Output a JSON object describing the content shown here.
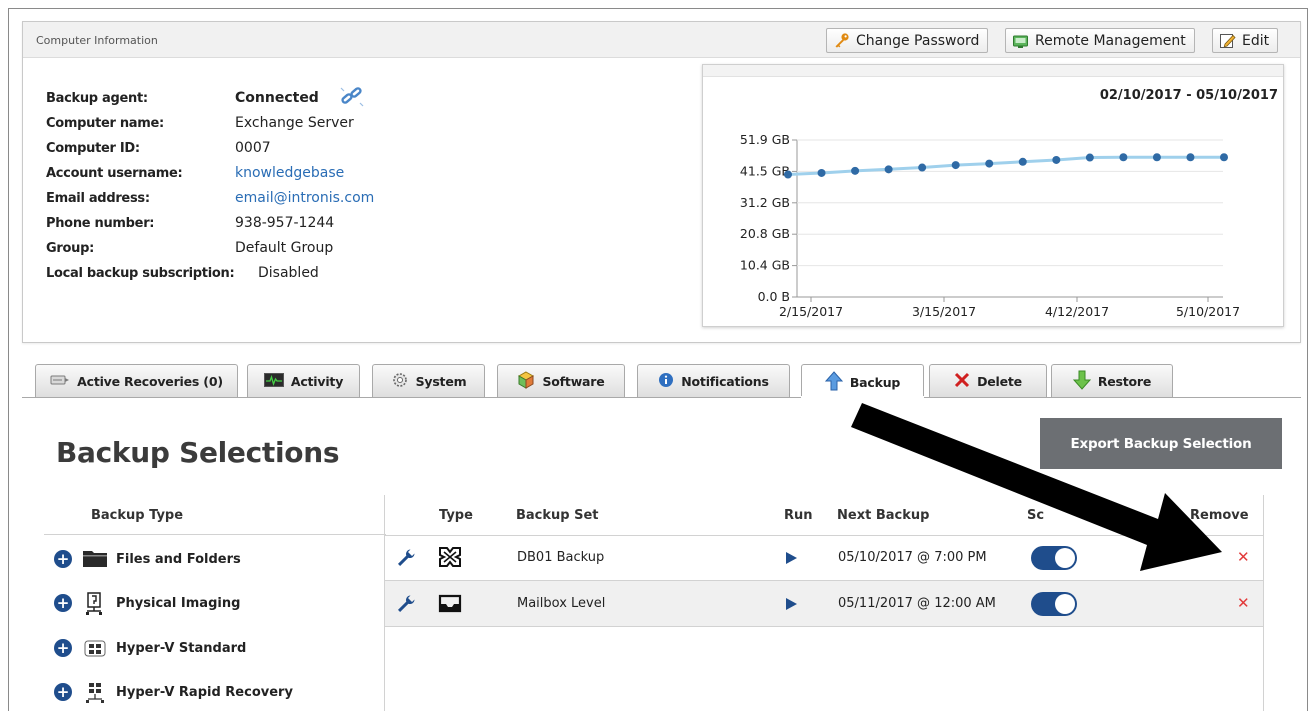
{
  "info": {
    "title": "Computer Information",
    "buttons": {
      "change_password": "Change Password",
      "remote_management": "Remote Management",
      "edit": "Edit"
    },
    "fields": [
      {
        "key": "Backup agent:",
        "value": "Connected"
      },
      {
        "key": "Computer name:",
        "value": "Exchange Server"
      },
      {
        "key": "Computer ID:",
        "value": "0007"
      },
      {
        "key": "Account username:",
        "value": "knowledgebase"
      },
      {
        "key": "Email address:",
        "value": "email@intronis.com"
      },
      {
        "key": "Phone number:",
        "value": "938-957-1244"
      },
      {
        "key": "Group:",
        "value": "Default Group"
      },
      {
        "key": "Local backup subscription:",
        "value": "Disabled"
      }
    ]
  },
  "chart_data": {
    "type": "line",
    "date_range": "02/10/2017 - 05/10/2017",
    "y_ticks": [
      "51.9 GB",
      "41.5 GB",
      "31.2 GB",
      "20.8 GB",
      "10.4 GB",
      "0.0 B"
    ],
    "x_ticks": [
      "2/15/2017",
      "3/15/2017",
      "4/12/2017",
      "5/10/2017"
    ],
    "ylim": [
      0,
      51.9
    ],
    "series": [
      {
        "values": [
          40.5,
          41.0,
          41.7,
          42.2,
          42.8,
          43.6,
          44.1,
          44.7,
          45.3,
          46.1,
          46.2,
          46.2,
          46.2,
          46.2
        ]
      }
    ],
    "color": "#9fd0ec",
    "marker_color": "#2f6aa5"
  },
  "tabs": [
    {
      "label": "Active Recoveries (0)",
      "icon": "recoveries-icon"
    },
    {
      "label": "Activity",
      "icon": "activity-icon"
    },
    {
      "label": "System",
      "icon": "system-icon"
    },
    {
      "label": "Software",
      "icon": "software-icon"
    },
    {
      "label": "Notifications",
      "icon": "info-icon"
    },
    {
      "label": "Backup",
      "icon": "up-arrow-icon"
    },
    {
      "label": "Delete",
      "icon": "x-icon"
    },
    {
      "label": "Restore",
      "icon": "down-arrow-icon"
    }
  ],
  "backup": {
    "title": "Backup Selections",
    "export_label": "Export Backup Selection",
    "types_header": "Backup Type",
    "types": [
      {
        "label": "Files and Folders",
        "icon": "folder-icon"
      },
      {
        "label": "Physical Imaging",
        "icon": "physical-imaging-icon"
      },
      {
        "label": "Hyper-V Standard",
        "icon": "hyperv-icon"
      },
      {
        "label": "Hyper-V Rapid Recovery",
        "icon": "hyperv-rapid-icon"
      }
    ],
    "columns": {
      "type": "Type",
      "set": "Backup Set",
      "run": "Run",
      "next": "Next Backup",
      "schedule": "Sc",
      "remove": "Remove"
    },
    "rows": [
      {
        "set": "DB01 Backup",
        "next": "05/10/2017 @ 7:00 PM",
        "type_icon": "exchange-db-icon",
        "enabled": true
      },
      {
        "set": "Mailbox Level",
        "next": "05/11/2017 @ 12:00 AM",
        "type_icon": "mailbox-icon",
        "enabled": true
      }
    ]
  }
}
